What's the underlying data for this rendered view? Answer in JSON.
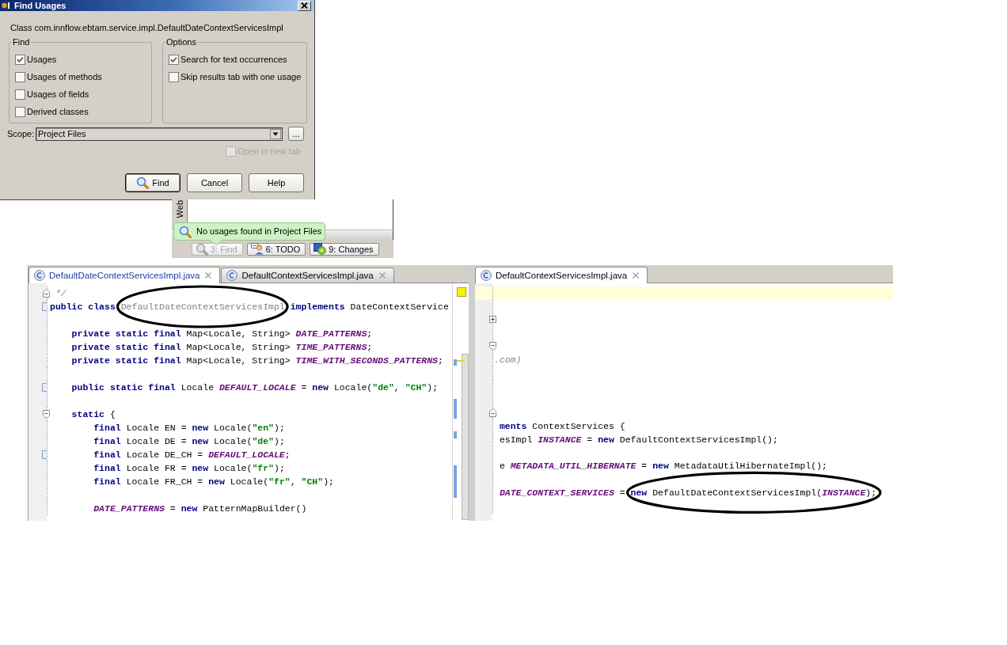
{
  "find_usages_dialog": {
    "title": "Find Usages",
    "target": "Class com.innflow.ebtam.service.impl.DefaultDateContextServicesImpl",
    "find_group": {
      "title": "Find",
      "options": [
        {
          "label": "Usages",
          "checked": true
        },
        {
          "label": "Usages of methods",
          "checked": false
        },
        {
          "label": "Usages of fields",
          "checked": false
        },
        {
          "label": "Derived classes",
          "checked": false
        }
      ]
    },
    "options_group": {
      "title": "Options",
      "options": [
        {
          "label": "Search for text occurrences",
          "checked": true
        },
        {
          "label": "Skip results tab with one usage",
          "checked": false
        }
      ]
    },
    "scope": {
      "label": "Scope:",
      "value": "Project Files",
      "browse_button": "..."
    },
    "open_in_new_tab": {
      "label": "Open in new tab",
      "checked": false,
      "disabled": true
    },
    "buttons": [
      {
        "label": "Find",
        "default": true
      },
      {
        "label": "Cancel",
        "default": false
      },
      {
        "label": "Help",
        "default": false
      }
    ]
  },
  "tool_window": {
    "side_tab": "Web",
    "tooltip": "No usages found in Project Files",
    "buttons": [
      {
        "label": "3: Find",
        "disabled": true
      },
      {
        "label": "6: TODO",
        "disabled": false
      },
      {
        "label": "9: Changes",
        "disabled": false
      }
    ]
  },
  "left_editor": {
    "tabs": [
      {
        "label": "DefaultDateContextServicesImpl.java",
        "selected": true,
        "modified": true
      },
      {
        "label": "DefaultContextServicesImpl.java",
        "selected": false,
        "modified": false
      }
    ],
    "lines": [
      {
        "highlighted": false,
        "gutter_icon": {
          "kind": "fold-end"
        },
        "tokens": [
          {
            "kind": "comment",
            "text": " */"
          }
        ]
      },
      {
        "highlighted": false,
        "gutter_icon": {
          "kind": "bracket"
        },
        "tokens": [
          {
            "kind": "keyword",
            "text": "public class "
          },
          {
            "kind": "unused",
            "text": "DefaultDateContextServicesImpl"
          },
          {
            "kind": "keyword",
            "text": " implements"
          },
          {
            "kind": "plain",
            "text": " DateContextService"
          }
        ]
      },
      {
        "highlighted": false
      },
      {
        "highlighted": false,
        "tokens": [
          {
            "kind": "keyword",
            "text": "    private static final"
          },
          {
            "kind": "plain",
            "text": " Map<Locale, String> "
          },
          {
            "kind": "constant",
            "text": "DATE_PATTERNS"
          },
          {
            "kind": "plain",
            "text": ";"
          }
        ]
      },
      {
        "highlighted": false,
        "tokens": [
          {
            "kind": "keyword",
            "text": "    private static final"
          },
          {
            "kind": "plain",
            "text": " Map<Locale, String> "
          },
          {
            "kind": "constant",
            "text": "TIME_PATTERNS"
          },
          {
            "kind": "plain",
            "text": ";"
          }
        ]
      },
      {
        "highlighted": false,
        "tokens": [
          {
            "kind": "keyword",
            "text": "    private static final"
          },
          {
            "kind": "plain",
            "text": " Map<Locale, String> "
          },
          {
            "kind": "constant",
            "text": "TIME_WITH_SECONDS_PATTERNS"
          },
          {
            "kind": "plain",
            "text": ";"
          }
        ]
      },
      {
        "highlighted": false
      },
      {
        "highlighted": false,
        "gutter_icon": {
          "kind": "bracket"
        },
        "tokens": [
          {
            "kind": "keyword",
            "text": "    public static final"
          },
          {
            "kind": "plain",
            "text": " Locale "
          },
          {
            "kind": "constant",
            "text": "DEFAULT_LOCALE"
          },
          {
            "kind": "plain",
            "text": " = "
          },
          {
            "kind": "keyword",
            "text": "new"
          },
          {
            "kind": "plain",
            "text": " Locale("
          },
          {
            "kind": "string",
            "text": "\"de\""
          },
          {
            "kind": "plain",
            "text": ", "
          },
          {
            "kind": "string",
            "text": "\"CH\""
          },
          {
            "kind": "plain",
            "text": ");"
          }
        ]
      },
      {
        "highlighted": false
      },
      {
        "highlighted": false,
        "gutter_icon": {
          "kind": "fold-start"
        },
        "tokens": [
          {
            "kind": "keyword",
            "text": "    static"
          },
          {
            "kind": "plain",
            "text": " {"
          }
        ]
      },
      {
        "highlighted": false,
        "tokens": [
          {
            "kind": "keyword",
            "text": "        final"
          },
          {
            "kind": "plain",
            "text": " Locale EN = "
          },
          {
            "kind": "keyword",
            "text": "new"
          },
          {
            "kind": "plain",
            "text": " Locale("
          },
          {
            "kind": "string",
            "text": "\"en\""
          },
          {
            "kind": "plain",
            "text": ");"
          }
        ]
      },
      {
        "highlighted": false,
        "tokens": [
          {
            "kind": "keyword",
            "text": "        final"
          },
          {
            "kind": "plain",
            "text": " Locale DE = "
          },
          {
            "kind": "keyword",
            "text": "new"
          },
          {
            "kind": "plain",
            "text": " Locale("
          },
          {
            "kind": "string",
            "text": "\"de\""
          },
          {
            "kind": "plain",
            "text": ");"
          }
        ]
      },
      {
        "highlighted": false,
        "gutter_icon": {
          "kind": "bracket"
        },
        "tokens": [
          {
            "kind": "keyword",
            "text": "        final"
          },
          {
            "kind": "plain",
            "text": " Locale DE_CH = "
          },
          {
            "kind": "constant",
            "text": "DEFAULT_LOCALE"
          },
          {
            "kind": "plain",
            "text": ";"
          }
        ]
      },
      {
        "highlighted": false,
        "tokens": [
          {
            "kind": "keyword",
            "text": "        final"
          },
          {
            "kind": "plain",
            "text": " Locale FR = "
          },
          {
            "kind": "keyword",
            "text": "new"
          },
          {
            "kind": "plain",
            "text": " Locale("
          },
          {
            "kind": "string",
            "text": "\"fr\""
          },
          {
            "kind": "plain",
            "text": ");"
          }
        ]
      },
      {
        "highlighted": false,
        "tokens": [
          {
            "kind": "keyword",
            "text": "        final"
          },
          {
            "kind": "plain",
            "text": " Locale FR_CH = "
          },
          {
            "kind": "keyword",
            "text": "new"
          },
          {
            "kind": "plain",
            "text": " Locale("
          },
          {
            "kind": "string",
            "text": "\"fr\""
          },
          {
            "kind": "plain",
            "text": ", "
          },
          {
            "kind": "string",
            "text": "\"CH\""
          },
          {
            "kind": "plain",
            "text": ");"
          }
        ]
      },
      {
        "highlighted": false
      },
      {
        "highlighted": false,
        "tokens": [
          {
            "kind": "constant",
            "text": "        DATE_PATTERNS"
          },
          {
            "kind": "plain",
            "text": " = "
          },
          {
            "kind": "keyword",
            "text": "new"
          },
          {
            "kind": "plain",
            "text": " PatternMapBuilder()"
          }
        ]
      }
    ]
  },
  "right_editor": {
    "tabs": [
      {
        "label": "DefaultContextServicesImpl.java",
        "selected": true,
        "modified": false
      }
    ],
    "lines": [
      {
        "highlighted": true
      },
      {
        "highlighted": false
      },
      {
        "highlighted": false,
        "gutter_icon": {
          "kind": "fold-expand"
        }
      },
      {
        "highlighted": false
      },
      {
        "highlighted": false,
        "gutter_icon": {
          "kind": "fold-start"
        }
      },
      {
        "highlighted": false,
        "tokens": [
          {
            "kind": "comment",
            "text": ".com)"
          }
        ]
      },
      {
        "highlighted": false
      },
      {
        "highlighted": false
      },
      {
        "highlighted": false
      },
      {
        "highlighted": false,
        "gutter_icon": {
          "kind": "fold-end"
        }
      },
      {
        "highlighted": false,
        "tokens": [
          {
            "kind": "keyword",
            "text": " ments"
          },
          {
            "kind": "plain",
            "text": " ContextServices {"
          }
        ]
      },
      {
        "highlighted": false,
        "tokens": [
          {
            "kind": "plain",
            "text": " esImpl "
          },
          {
            "kind": "constant",
            "text": "INSTANCE"
          },
          {
            "kind": "plain",
            "text": " = "
          },
          {
            "kind": "keyword",
            "text": "new"
          },
          {
            "kind": "plain",
            "text": " DefaultContextServicesImpl();"
          }
        ]
      },
      {
        "highlighted": false
      },
      {
        "highlighted": false,
        "tokens": [
          {
            "kind": "plain",
            "text": " e "
          },
          {
            "kind": "constant",
            "text": "METADATA_UTIL_HIBERNATE"
          },
          {
            "kind": "plain",
            "text": " = "
          },
          {
            "kind": "keyword",
            "text": "new"
          },
          {
            "kind": "plain",
            "text": " MetadataUtilHibernateImpl();"
          }
        ]
      },
      {
        "highlighted": false
      },
      {
        "highlighted": false,
        "tokens": [
          {
            "kind": "constant",
            "text": " DATE_CONTEXT_SERVICES"
          },
          {
            "kind": "plain",
            "text": " = "
          },
          {
            "kind": "keyword",
            "text": "new"
          },
          {
            "kind": "plain",
            "text": " DefaultDateContextServicesImpl("
          },
          {
            "kind": "constant",
            "text": "INSTANCE"
          },
          {
            "kind": "plain",
            "text": ");"
          }
        ]
      },
      {
        "highlighted": false
      }
    ]
  }
}
